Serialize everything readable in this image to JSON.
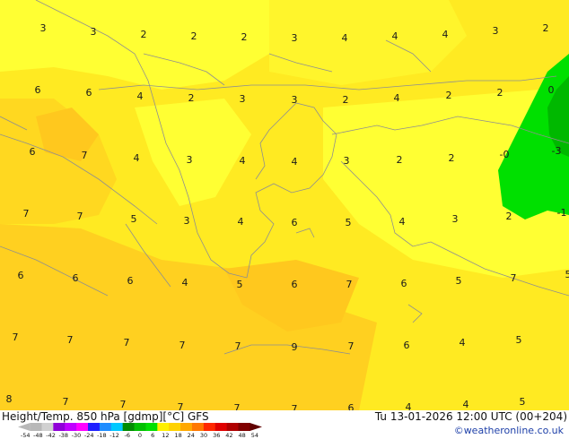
{
  "map": {
    "title": "Height/Temp. 850 hPa [gdmp][°C] GFS",
    "valid_time": "Tu 13-01-2026 12:00 UTC (00+204)",
    "credit": "©weatheronline.co.uk",
    "colors": {
      "field_light": "#ffff33",
      "field_mid": "#ffe41c",
      "field_warm": "#ffcf1e",
      "green": "#00e000",
      "green_dark": "#00b800",
      "coast": "#8f8f8f"
    },
    "labels": [
      "3",
      "3",
      "2",
      "2",
      "2",
      "3",
      "4",
      "4",
      "4",
      "3",
      "2",
      "6",
      "6",
      "4",
      "2",
      "3",
      "3",
      "2",
      "4",
      "2",
      "2",
      "0",
      "6",
      "7",
      "4",
      "3",
      "4",
      "4",
      "3",
      "2",
      "2",
      "-0",
      "-3",
      "7",
      "7",
      "5",
      "3",
      "4",
      "6",
      "5",
      "4",
      "3",
      "2",
      "-1",
      "6",
      "6",
      "6",
      "4",
      "5",
      "6",
      "7",
      "6",
      "5",
      "7",
      "5",
      "7",
      "7",
      "7",
      "7",
      "7",
      "9",
      "7",
      "6",
      "4",
      "5",
      "8",
      "7",
      "7",
      "7",
      "7",
      "7",
      "6",
      "4",
      "4",
      "5"
    ],
    "colorbar": {
      "ticks": [
        "-54",
        "-48",
        "-42",
        "-38",
        "-30",
        "-24",
        "-18",
        "-12",
        "-6",
        "0",
        "6",
        "12",
        "18",
        "24",
        "30",
        "36",
        "42",
        "48",
        "54"
      ],
      "colors": [
        "#b8b8b8",
        "#d0d0d0",
        "#9000d8",
        "#c000ff",
        "#ff00ff",
        "#2020ff",
        "#1e8cff",
        "#00c8ff",
        "#008c00",
        "#00c000",
        "#00e000",
        "#fff000",
        "#ffd200",
        "#ffa800",
        "#ff7800",
        "#ff2800",
        "#e00000",
        "#b00000",
        "#800000"
      ]
    }
  }
}
